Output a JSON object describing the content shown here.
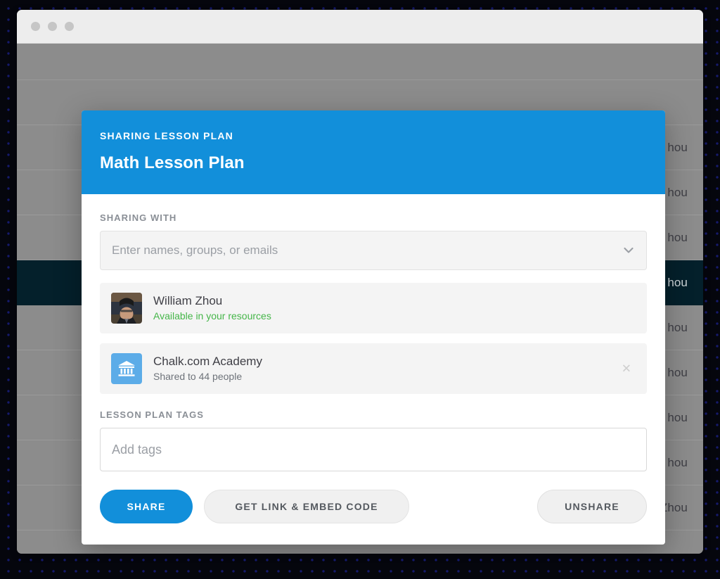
{
  "window": {
    "traffic_lights": [
      "close",
      "minimize",
      "maximize"
    ]
  },
  "background": {
    "rows": [
      {
        "text": ""
      },
      {
        "text": ""
      },
      {
        "text": "hou",
        "selected": false
      },
      {
        "text": "hou",
        "selected": false
      },
      {
        "text": "hou",
        "selected": false
      },
      {
        "text": "hou",
        "selected": true
      },
      {
        "text": "hou",
        "selected": false
      },
      {
        "text": "hou",
        "selected": false
      },
      {
        "text": "hou",
        "selected": false
      },
      {
        "text": "hou",
        "selected": false
      },
      {
        "text": "William Zhou",
        "selected": false
      }
    ]
  },
  "modal": {
    "eyebrow": "SHARING LESSON PLAN",
    "title": "Math Lesson Plan",
    "accent_color": "#128fda",
    "sharing_with": {
      "label": "SHARING WITH",
      "input_placeholder": "Enter names, groups, or emails",
      "input_value": "",
      "chevron_icon": "chevron-down-icon",
      "entities": [
        {
          "name": "William Zhou",
          "subtitle": "Available in your resources",
          "subtitle_state": "available",
          "subtitle_color": "#45b649",
          "avatar_type": "photo",
          "removable": false
        },
        {
          "name": "Chalk.com Academy",
          "subtitle": "Shared to 44 people",
          "subtitle_state": "muted",
          "subtitle_color": "#6e737a",
          "avatar_type": "institution-icon",
          "avatar_color": "#5cace8",
          "removable": true,
          "remove_label": "✕"
        }
      ]
    },
    "tags": {
      "label": "LESSON PLAN TAGS",
      "input_placeholder": "Add tags",
      "input_value": ""
    },
    "actions": {
      "share": "SHARE",
      "get_link": "GET LINK & EMBED CODE",
      "unshare": "UNSHARE"
    }
  }
}
